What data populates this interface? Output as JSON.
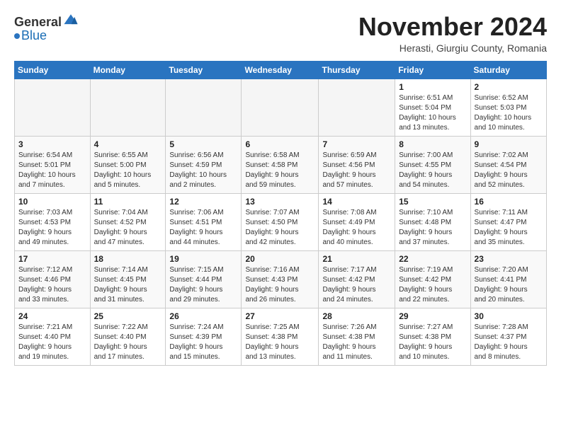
{
  "header": {
    "logo_general": "General",
    "logo_blue": "Blue",
    "month_title": "November 2024",
    "subtitle": "Herasti, Giurgiu County, Romania"
  },
  "weekdays": [
    "Sunday",
    "Monday",
    "Tuesday",
    "Wednesday",
    "Thursday",
    "Friday",
    "Saturday"
  ],
  "weeks": [
    [
      {
        "day": "",
        "info": ""
      },
      {
        "day": "",
        "info": ""
      },
      {
        "day": "",
        "info": ""
      },
      {
        "day": "",
        "info": ""
      },
      {
        "day": "",
        "info": ""
      },
      {
        "day": "1",
        "info": "Sunrise: 6:51 AM\nSunset: 5:04 PM\nDaylight: 10 hours\nand 13 minutes."
      },
      {
        "day": "2",
        "info": "Sunrise: 6:52 AM\nSunset: 5:03 PM\nDaylight: 10 hours\nand 10 minutes."
      }
    ],
    [
      {
        "day": "3",
        "info": "Sunrise: 6:54 AM\nSunset: 5:01 PM\nDaylight: 10 hours\nand 7 minutes."
      },
      {
        "day": "4",
        "info": "Sunrise: 6:55 AM\nSunset: 5:00 PM\nDaylight: 10 hours\nand 5 minutes."
      },
      {
        "day": "5",
        "info": "Sunrise: 6:56 AM\nSunset: 4:59 PM\nDaylight: 10 hours\nand 2 minutes."
      },
      {
        "day": "6",
        "info": "Sunrise: 6:58 AM\nSunset: 4:58 PM\nDaylight: 9 hours\nand 59 minutes."
      },
      {
        "day": "7",
        "info": "Sunrise: 6:59 AM\nSunset: 4:56 PM\nDaylight: 9 hours\nand 57 minutes."
      },
      {
        "day": "8",
        "info": "Sunrise: 7:00 AM\nSunset: 4:55 PM\nDaylight: 9 hours\nand 54 minutes."
      },
      {
        "day": "9",
        "info": "Sunrise: 7:02 AM\nSunset: 4:54 PM\nDaylight: 9 hours\nand 52 minutes."
      }
    ],
    [
      {
        "day": "10",
        "info": "Sunrise: 7:03 AM\nSunset: 4:53 PM\nDaylight: 9 hours\nand 49 minutes."
      },
      {
        "day": "11",
        "info": "Sunrise: 7:04 AM\nSunset: 4:52 PM\nDaylight: 9 hours\nand 47 minutes."
      },
      {
        "day": "12",
        "info": "Sunrise: 7:06 AM\nSunset: 4:51 PM\nDaylight: 9 hours\nand 44 minutes."
      },
      {
        "day": "13",
        "info": "Sunrise: 7:07 AM\nSunset: 4:50 PM\nDaylight: 9 hours\nand 42 minutes."
      },
      {
        "day": "14",
        "info": "Sunrise: 7:08 AM\nSunset: 4:49 PM\nDaylight: 9 hours\nand 40 minutes."
      },
      {
        "day": "15",
        "info": "Sunrise: 7:10 AM\nSunset: 4:48 PM\nDaylight: 9 hours\nand 37 minutes."
      },
      {
        "day": "16",
        "info": "Sunrise: 7:11 AM\nSunset: 4:47 PM\nDaylight: 9 hours\nand 35 minutes."
      }
    ],
    [
      {
        "day": "17",
        "info": "Sunrise: 7:12 AM\nSunset: 4:46 PM\nDaylight: 9 hours\nand 33 minutes."
      },
      {
        "day": "18",
        "info": "Sunrise: 7:14 AM\nSunset: 4:45 PM\nDaylight: 9 hours\nand 31 minutes."
      },
      {
        "day": "19",
        "info": "Sunrise: 7:15 AM\nSunset: 4:44 PM\nDaylight: 9 hours\nand 29 minutes."
      },
      {
        "day": "20",
        "info": "Sunrise: 7:16 AM\nSunset: 4:43 PM\nDaylight: 9 hours\nand 26 minutes."
      },
      {
        "day": "21",
        "info": "Sunrise: 7:17 AM\nSunset: 4:42 PM\nDaylight: 9 hours\nand 24 minutes."
      },
      {
        "day": "22",
        "info": "Sunrise: 7:19 AM\nSunset: 4:42 PM\nDaylight: 9 hours\nand 22 minutes."
      },
      {
        "day": "23",
        "info": "Sunrise: 7:20 AM\nSunset: 4:41 PM\nDaylight: 9 hours\nand 20 minutes."
      }
    ],
    [
      {
        "day": "24",
        "info": "Sunrise: 7:21 AM\nSunset: 4:40 PM\nDaylight: 9 hours\nand 19 minutes."
      },
      {
        "day": "25",
        "info": "Sunrise: 7:22 AM\nSunset: 4:40 PM\nDaylight: 9 hours\nand 17 minutes."
      },
      {
        "day": "26",
        "info": "Sunrise: 7:24 AM\nSunset: 4:39 PM\nDaylight: 9 hours\nand 15 minutes."
      },
      {
        "day": "27",
        "info": "Sunrise: 7:25 AM\nSunset: 4:38 PM\nDaylight: 9 hours\nand 13 minutes."
      },
      {
        "day": "28",
        "info": "Sunrise: 7:26 AM\nSunset: 4:38 PM\nDaylight: 9 hours\nand 11 minutes."
      },
      {
        "day": "29",
        "info": "Sunrise: 7:27 AM\nSunset: 4:38 PM\nDaylight: 9 hours\nand 10 minutes."
      },
      {
        "day": "30",
        "info": "Sunrise: 7:28 AM\nSunset: 4:37 PM\nDaylight: 9 hours\nand 8 minutes."
      }
    ]
  ]
}
